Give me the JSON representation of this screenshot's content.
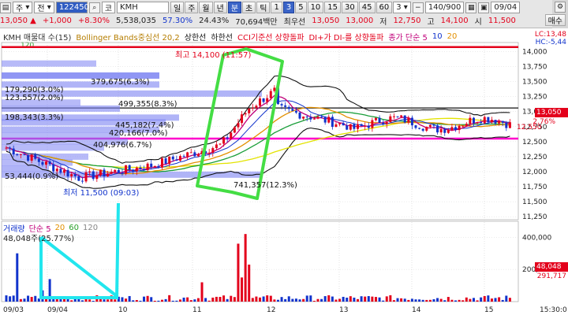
{
  "toolbar": {
    "period_label": "주",
    "period_option": "전",
    "stock_code": "122450",
    "market_label": "코",
    "stock_name": "KMH",
    "timeframes": [
      "일",
      "주",
      "월",
      "년",
      "분",
      "초",
      "틱"
    ],
    "active_timeframe": "분",
    "intervals": [
      "1",
      "3",
      "5",
      "10",
      "15",
      "30",
      "45",
      "60"
    ],
    "active_interval": "3",
    "count_value": "140/900",
    "end_date": "09/04",
    "price": "13,050",
    "change": "+1,000",
    "change_pct": "+8.30%",
    "volume": "5,538,035",
    "ratio": "57.30%",
    "ratio2": "24.43%",
    "amount": "70,694백만",
    "priority_label": "최우선",
    "ask": "13,050",
    "bid": "13,000",
    "low_label": "저",
    "low": "12,750",
    "high_label": "고",
    "high": "14,100",
    "prev_label": "시",
    "prev": "11,500",
    "sell_button": "매수",
    "side_option": "3"
  },
  "legend": {
    "items": [
      "KMH 매물대 수(15)",
      "Bollinger Bands중심선 20,2",
      "상한선",
      "하한선",
      "CCI기준선 상향돌파",
      "DI+가 DI-를 상향돌파",
      "종가 단순 5",
      "10",
      "20"
    ],
    "right": "LC:13,48",
    "right2": "HC:-5,44",
    "sub": "120"
  },
  "price_axis": {
    "ticks": [
      "14,000",
      "13,750",
      "13,500",
      "13,250",
      "13,000",
      "12,750",
      "12,500",
      "12,250",
      "12,000",
      "11,750",
      "11,500",
      "11,250"
    ],
    "current": "13,050",
    "current_pct": "2.76%",
    "line_price": "12,550"
  },
  "annotations": {
    "high": "최고 14,100 (11:57)",
    "low": "최저 11,500 (09:03)"
  },
  "profile": [
    {
      "label": "179,290(3.0%)"
    },
    {
      "label": "123,557(2.0%)"
    },
    {
      "label": "379,675(6.3%)"
    },
    {
      "label": "499,355(8.3%)"
    },
    {
      "label": "198,343(3.3%)"
    },
    {
      "label": "445,182(7.4%)"
    },
    {
      "label": "420,166(7.0%)"
    },
    {
      "label": "404,976(6.7%)"
    },
    {
      "label": "53,444(0.9%)"
    },
    {
      "label": "741,357(12.3%)"
    }
  ],
  "volume": {
    "legend": [
      "거래량",
      "단순 5",
      "20",
      "60",
      "120"
    ],
    "value": "48,048주(25.77%)",
    "ticks": [
      "400,000",
      "200,000"
    ],
    "current": "48,048",
    "current2": "291,717"
  },
  "time_axis": [
    "09/03",
    "09/04",
    "10",
    "11",
    "12",
    "13",
    "14",
    "15",
    "15:30:0"
  ],
  "colors": {
    "accent_blue": "#3a64c8",
    "up_red": "#e3001b",
    "down_blue": "#1133cc",
    "highlight_green": "#44dd44",
    "highlight_cyan": "#22e6ee",
    "magenta_line": "#ff00cc",
    "profile_fill": "#7b82f2"
  }
}
